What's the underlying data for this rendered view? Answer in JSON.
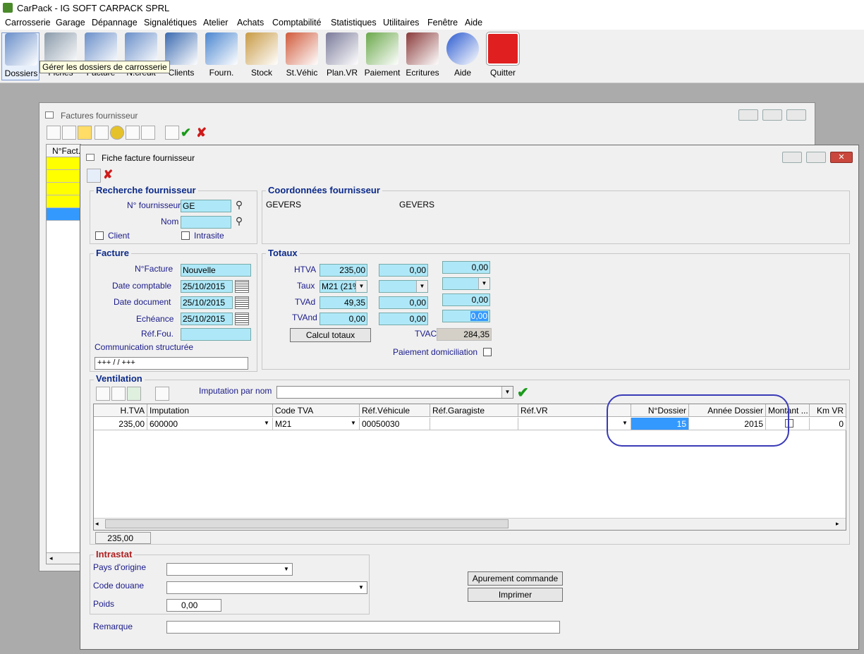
{
  "app": {
    "title": "CarPack - IG SOFT CARPACK SPRL"
  },
  "menu": [
    "Carrosserie",
    "Garage",
    "Dépannage",
    "Signalétiques",
    "Atelier",
    "Achats",
    "Comptabilité",
    "Statistiques",
    "Utilitaires",
    "Fenêtre",
    "Aide"
  ],
  "toolbar": [
    {
      "label": "Dossiers",
      "icon": "folder-documents-icon",
      "color": "#6a8fc9"
    },
    {
      "label": "Fiches",
      "icon": "tools-icon",
      "color": "#8a9aaa"
    },
    {
      "label": "Facture",
      "icon": "invoice-icon",
      "color": "#6a8fc9"
    },
    {
      "label": "N.crédit",
      "icon": "credit-note-icon",
      "color": "#6a8fc9"
    },
    {
      "label": "Clients",
      "icon": "client-person-icon",
      "color": "#3a6ab0"
    },
    {
      "label": "Fourn.",
      "icon": "supplier-truck-icon",
      "color": "#4a86d0"
    },
    {
      "label": "Stock",
      "icon": "stock-boxes-icon",
      "color": "#c89a44"
    },
    {
      "label": "St.Véhic",
      "icon": "vehicles-icon",
      "color": "#d05a3a"
    },
    {
      "label": "Plan.VR",
      "icon": "keys-icon",
      "color": "#7a7a9a"
    },
    {
      "label": "Paiement",
      "icon": "payment-icon",
      "color": "#6aa84a"
    },
    {
      "label": "Ecritures",
      "icon": "books-icon",
      "color": "#8a3a3a"
    },
    {
      "label": "Aide",
      "icon": "help-icon",
      "color": "#2a5ad0"
    },
    {
      "label": "Quitter",
      "icon": "power-icon",
      "color": "#e02020"
    }
  ],
  "tooltip": "Gérer les dossiers de carrosserie",
  "back_window": {
    "title": "Factures fournisseur",
    "col_header": "N°Fact."
  },
  "front_window": {
    "title": "Fiche facture fournisseur"
  },
  "recherche": {
    "title": "Recherche fournisseur",
    "num_label": "N° fournisseur",
    "num_value": "GE",
    "nom_label": "Nom",
    "nom_value": "",
    "client_label": "Client",
    "intrasite_label": "Intrasite"
  },
  "coordonnees": {
    "title": "Coordonnées fournisseur",
    "code": "GEVERS",
    "name": "GEVERS"
  },
  "facture": {
    "title": "Facture",
    "num_label": "N°Facture",
    "num_value": "Nouvelle",
    "date_comptable_label": "Date comptable",
    "date_comptable": "25/10/2015",
    "date_document_label": "Date document",
    "date_document": "25/10/2015",
    "echeance_label": "Echéance",
    "echeance": "25/10/2015",
    "ref_label": "Réf.Fou.",
    "ref_value": "",
    "comm_label": "Communication structurée",
    "comm_value": "+++  /   /    +++"
  },
  "totaux": {
    "title": "Totaux",
    "htva_label": "HTVA",
    "htva": [
      "235,00",
      "0,00",
      "0,00"
    ],
    "taux_label": "Taux",
    "taux": [
      "M21 (21%",
      "",
      ""
    ],
    "tvad_label": "TVAd",
    "tvad": [
      "49,35",
      "0,00",
      "0,00"
    ],
    "tvand_label": "TVAnd",
    "tvand": [
      "0,00",
      "0,00",
      "0,00"
    ],
    "calc_button": "Calcul totaux",
    "tvac_label": "TVAC",
    "tvac": "284,35",
    "paiement_label": "Paiement domiciliation"
  },
  "ventilation": {
    "title": "Ventilation",
    "imputation_label": "Imputation par nom",
    "imputation_value": "",
    "columns": [
      "H.TVA",
      "Imputation",
      "Code TVA",
      "Réf.Véhicule",
      "Réf.Garagiste",
      "Réf.VR",
      "",
      "N°Dossier",
      "Année Dossier",
      "Montant ...",
      "Km VR"
    ],
    "row": {
      "htva": "235,00",
      "imputation": "600000",
      "code_tva": "M21",
      "ref_vehicule": "00050030",
      "ref_garagiste": "",
      "ref_vr": "",
      "n_dossier": "15",
      "annee": "2015",
      "km": "0"
    },
    "total": "235,00"
  },
  "intrastat": {
    "title": "Intrastat",
    "pays_label": "Pays d'origine",
    "pays": "",
    "douane_label": "Code douane",
    "douane": "",
    "poids_label": "Poids",
    "poids": "0,00"
  },
  "buttons": {
    "apurement": "Apurement commande",
    "imprimer": "Imprimer"
  },
  "remarque": {
    "label": "Remarque",
    "value": ""
  },
  "colors": {
    "highlight": "#3399ff",
    "field": "#aee8f8",
    "yellow": "#ffff00",
    "annotation": "#3a3ab8"
  }
}
